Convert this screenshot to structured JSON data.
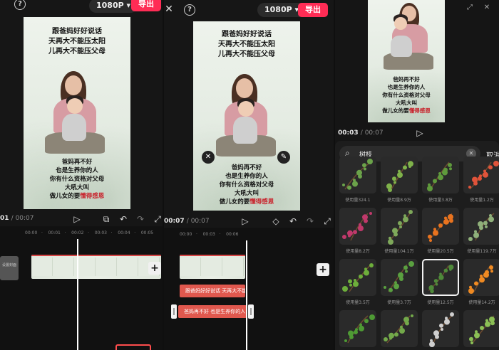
{
  "editor1": {
    "help_icon": "?",
    "resolution": "1080P ▾",
    "export_label": "导出",
    "caption_top": [
      "跟爸妈好好说话",
      "天再大不能压太阳",
      "儿再大不能压父母"
    ],
    "caption_bottom": [
      "爸妈再不好",
      "也是生养你的人",
      "你有什么资格对父母",
      "大吼大叫"
    ],
    "caption_last_plain": "做儿女的要",
    "caption_last_red": "懂得感恩",
    "time_current": "01",
    "time_total": "/ 00:07",
    "ruler": [
      "00:00",
      "00:01",
      "00:02",
      "00:03",
      "00:04",
      "00:05"
    ],
    "cover_label": "设置封面"
  },
  "editor2": {
    "close_icon": "✕",
    "help_icon": "?",
    "resolution": "1080P ▾",
    "export_label": "导出",
    "caption_top": [
      "跟爸妈好好说话",
      "天再大不能压太阳",
      "儿再大不能压父母"
    ],
    "caption_bottom": [
      "爸妈再不好",
      "也是生养你的人",
      "你有什么资格对父母",
      "大吼大叫"
    ],
    "caption_last_plain": "做儿女的要",
    "caption_last_red": "懂得感恩",
    "time_current": "00:07",
    "time_total": "/ 00:07",
    "ruler": [
      "00:00",
      "00:03",
      "00:06"
    ],
    "text_clip_1": "跟爸妈好好说话 天再大不能",
    "text_clip_2": "爸妈再不好 也是生养你的人"
  },
  "stickers": {
    "caption_bottom": [
      "爸妈再不好",
      "也是生养你的人",
      "你有什么资格对父母",
      "大吼大叫"
    ],
    "caption_last_plain": "做儿女的要",
    "caption_last_red": "懂得感恩",
    "time_current": "00:03",
    "time_total": "/ 00:07",
    "search_query": "树枝",
    "cancel_label": "取消",
    "items": [
      {
        "caption": "使用量324.1",
        "color": "#6ba34a"
      },
      {
        "caption": "使用量8.9万",
        "color": "#7fb24a"
      },
      {
        "caption": "使用量3.8万",
        "color": "#5f9a3c"
      },
      {
        "caption": "使用量1.2万",
        "color": "#e0533a"
      },
      {
        "caption": "使用量8.2万",
        "color": "#c0396b"
      },
      {
        "caption": "使用量104.1万",
        "color": "#7ea85a"
      },
      {
        "caption": "使用量20.5万",
        "color": "#e8731f"
      },
      {
        "caption": "使用量119.7万",
        "color": "#8fb07a"
      },
      {
        "caption": "使用量3.5万",
        "color": "#6dae3b"
      },
      {
        "caption": "使用量3.7万",
        "color": "#5aa040"
      },
      {
        "caption": "使用量12.5万",
        "color": "#4f8a3a"
      },
      {
        "caption": "使用量14.2万",
        "color": "#ef8a22"
      },
      {
        "caption": "使用量10.1万",
        "color": "#4e9a34"
      },
      {
        "caption": "使用量4.1万",
        "color": "#73a94a"
      },
      {
        "caption": "使用量123.6万",
        "color": "#cfcfcf"
      },
      {
        "caption": "使用量6.5万",
        "color": "#8bbf55"
      }
    ]
  }
}
